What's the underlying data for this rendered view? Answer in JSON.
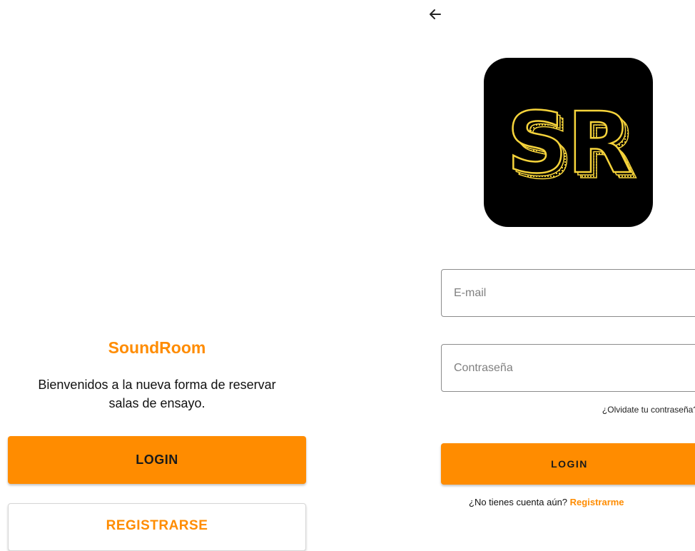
{
  "welcome": {
    "title": "SoundRoom",
    "tagline_line1": "Bienvenidos a la nueva forma de reservar",
    "tagline_line2": "salas de ensayo.",
    "login_label": "LOGIN",
    "register_label": "REGISTRARSE"
  },
  "login": {
    "back_icon": "arrow-left-icon",
    "logo_icon": "sr-logo-icon",
    "logo_text": "SR",
    "email_placeholder": "E-mail",
    "email_value": "",
    "password_placeholder": "Contraseña",
    "password_value": "",
    "forgot_label": "¿Olvidate tu contraseña?",
    "login_label": "LOGIN",
    "no_account_text": "¿No tienes cuenta aún?",
    "register_link": "Registrarme"
  },
  "colors": {
    "accent": "#ff8c00",
    "logo_bg": "#000000",
    "logo_yellow": "#f5d33b"
  }
}
